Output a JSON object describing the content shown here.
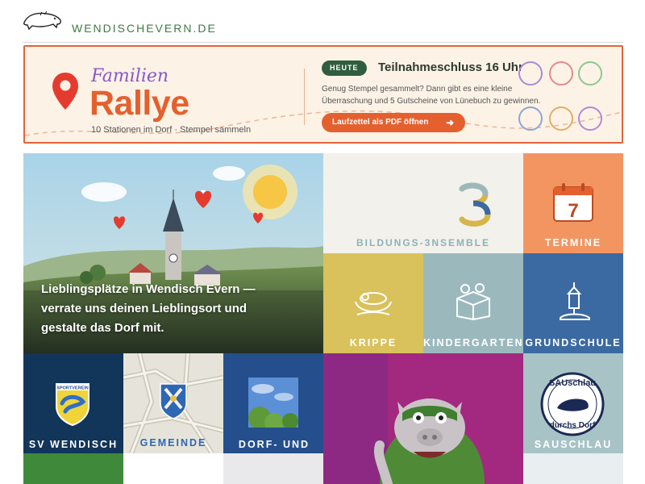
{
  "header": {
    "site_name": "WENDISCHEVERN.DE",
    "logo_icon": "boar-logo-icon"
  },
  "banner": {
    "title_script": "Familien",
    "title_main": "Rallye",
    "subtitle": "10 Stationen im Dorf · Stempel sammeln",
    "badge": "HEUTE",
    "deadline": "Teilnahmeschluss 16 Uhr",
    "description": "Genug Stempel gesammelt? Dann gibt es eine kleine Überraschung und 5 Gutscheine von Lünebuch zu gewinnen.",
    "button_label": "Laufzettel als PDF öffnen",
    "button_icon": "arrow-right-icon",
    "stamp_colors": [
      "#a88bd8",
      "#e28b8b",
      "#8dc98d",
      "#8aa6d8",
      "#e0b063",
      "#b08ad8"
    ]
  },
  "hero": {
    "text": "Lieblingsplätze in Wendisch Evern — verrate uns deinen Lieblingsort und gestalte das Dorf mit."
  },
  "tiles": {
    "bildung": {
      "number": "3",
      "label": "BILDUNGS-3NSEMBLE"
    },
    "termine": {
      "day": "7",
      "label": "TERMINE"
    },
    "krippe": {
      "label": "KRIPPE"
    },
    "kindergarten": {
      "label": "KINDERGARTEN"
    },
    "grundschule": {
      "label": "GRUNDSCHULE"
    },
    "sv": {
      "label": "SV WENDISCH EVERN",
      "crest_text": "SPORTVEREIN"
    },
    "gemeinde": {
      "label": "GEMEINDE"
    },
    "dorf": {
      "label": "DORF- UND SCHULENTWICKLUNG"
    },
    "sauschlau": {
      "label": "SAUSCHLAU DURCHS DORF",
      "badge_top": "SAUschlau",
      "badge_bottom": "durchs Dorf"
    }
  },
  "colors": {
    "accent_orange": "#e4602f",
    "green": "#3e7a45",
    "termine_bg": "#f39561",
    "krippe_bg": "#d9c15c",
    "kindergarten_bg": "#9bb9bd",
    "grundschule_bg": "#3b6aa2",
    "sv_bg": "#12355a",
    "dorf_bg": "#244f8c",
    "mascot_bg": "#a3287f",
    "sauschlau_bg": "#a8c3c6"
  }
}
